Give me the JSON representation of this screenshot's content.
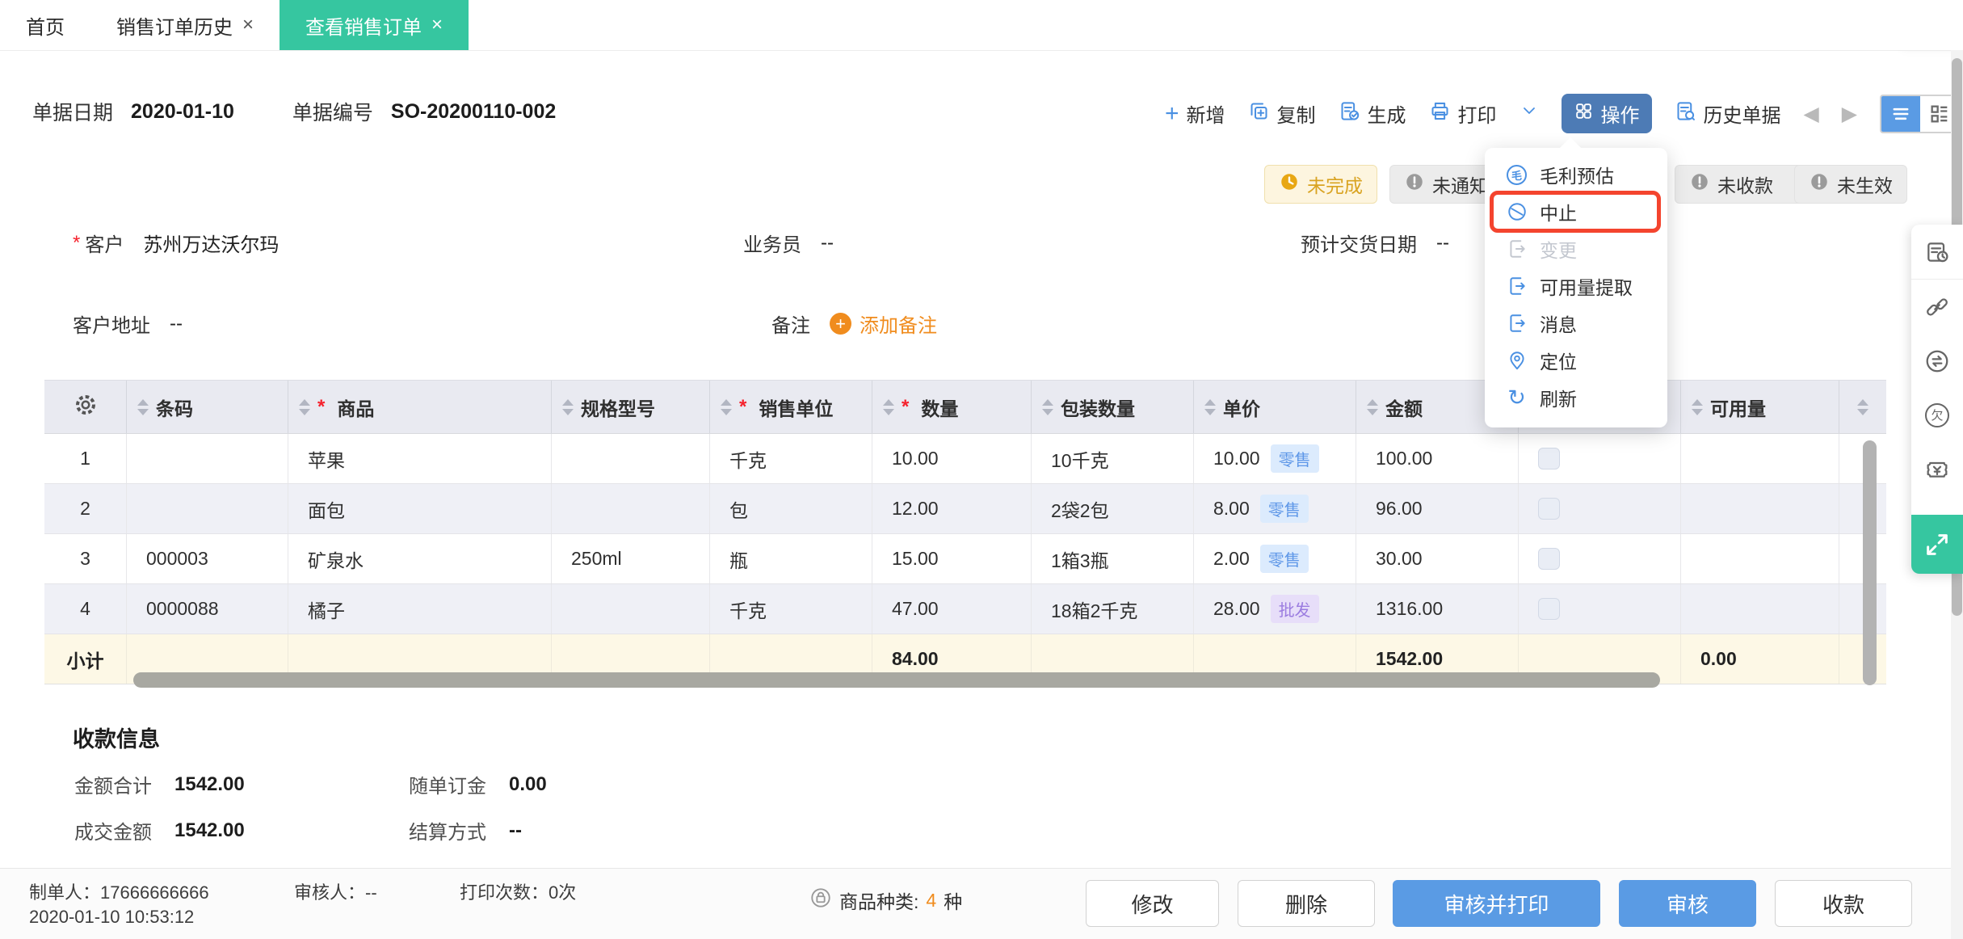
{
  "colors": {
    "teal": "#36c6a0",
    "icon_blue": "#4a90e2",
    "action_button_bg": "#4d7bb5",
    "primary_button_bg": "#5a9be4",
    "orange": "#f08c1e",
    "warning_text": "#d9a321",
    "highlight_red": "#f4442e",
    "tag_retail_text": "#5e97e8",
    "tag_wholesale_text": "#9b7ce0"
  },
  "tabbar": {
    "tabs": [
      {
        "label": "首页",
        "close": ""
      },
      {
        "label": "销售订单历史",
        "close": "×"
      },
      {
        "label": "查看销售订单",
        "close": "×"
      }
    ],
    "window_close": "×"
  },
  "header": {
    "date_label": "单据日期",
    "date_value": "2020-01-10",
    "no_label": "单据编号",
    "no_value": "SO-20200110-002",
    "toolbar": {
      "add": "新增",
      "copy": "复制",
      "generate": "生成",
      "print": "打印",
      "action": "操作",
      "history": "历史单据"
    }
  },
  "badges": [
    {
      "label": "未完成"
    },
    {
      "label": "未通知"
    },
    {
      "label": "未收款"
    },
    {
      "label": "未生效"
    }
  ],
  "action_menu": {
    "items": [
      {
        "label": "毛利预估",
        "glyph": "毛"
      },
      {
        "label": "中止"
      },
      {
        "label": "变更"
      },
      {
        "label": "可用量提取"
      },
      {
        "label": "消息"
      },
      {
        "label": "定位"
      },
      {
        "label": "刷新",
        "glyph": "↻"
      }
    ]
  },
  "form": {
    "required_mark": "*",
    "customer_label": "客户",
    "customer_value": "苏州万达沃尔玛",
    "salesman_label": "业务员",
    "salesman_value": "--",
    "delivery_label": "预计交货日期",
    "delivery_value": "--",
    "address_label": "客户地址",
    "address_value": "--",
    "remark_label": "备注",
    "add_remark_label": "添加备注"
  },
  "table": {
    "headers": {
      "barcode": "条码",
      "product": "商品",
      "spec": "规格型号",
      "unit": "销售单位",
      "qty": "数量",
      "pack_qty": "包装数量",
      "price": "单价",
      "amount": "金额",
      "available": "可用量"
    },
    "rows": [
      {
        "no": "1",
        "barcode": "",
        "product": "苹果",
        "spec": "",
        "unit": "千克",
        "qty": "10.00",
        "pack": "10千克",
        "price": "10.00",
        "price_tag": "零售",
        "amount": "100.00",
        "available": ""
      },
      {
        "no": "2",
        "barcode": "",
        "product": "面包",
        "spec": "",
        "unit": "包",
        "qty": "12.00",
        "pack": "2袋2包",
        "price": "8.00",
        "price_tag": "零售",
        "amount": "96.00",
        "available": ""
      },
      {
        "no": "3",
        "barcode": "000003",
        "product": "矿泉水",
        "spec": "250ml",
        "unit": "瓶",
        "qty": "15.00",
        "pack": "1箱3瓶",
        "price": "2.00",
        "price_tag": "零售",
        "amount": "30.00",
        "available": ""
      },
      {
        "no": "4",
        "barcode": "0000088",
        "product": "橘子",
        "spec": "",
        "unit": "千克",
        "qty": "47.00",
        "pack": "18箱2千克",
        "price": "28.00",
        "price_tag": "批发",
        "amount": "1316.00",
        "available": ""
      }
    ],
    "subtotal": {
      "label": "小计",
      "qty": "84.00",
      "amount": "1542.00",
      "available": "0.00"
    }
  },
  "payment": {
    "title": "收款信息",
    "total_label": "金额合计",
    "total_value": "1542.00",
    "deposit_label": "随单订金",
    "deposit_value": "0.00",
    "deal_label": "成交金额",
    "deal_value": "1542.00",
    "settle_label": "结算方式",
    "settle_value": "--"
  },
  "footer": {
    "creator_label": "制单人：",
    "creator_value": "17666666666",
    "created_time": "2020-01-10 10:53:12",
    "auditor_label": "审核人：",
    "auditor_value": "--",
    "print_count_label": "打印次数：",
    "print_count_value": "0次",
    "category_label": "商品种类:",
    "category_count": "4",
    "category_unit": "种",
    "buttons": {
      "edit": "修改",
      "delete": "删除",
      "audit_print": "审核并打印",
      "audit": "审核",
      "receive": "收款"
    }
  },
  "right_panel": {
    "debt_glyph": "欠",
    "coupon_glyph": "¥"
  }
}
